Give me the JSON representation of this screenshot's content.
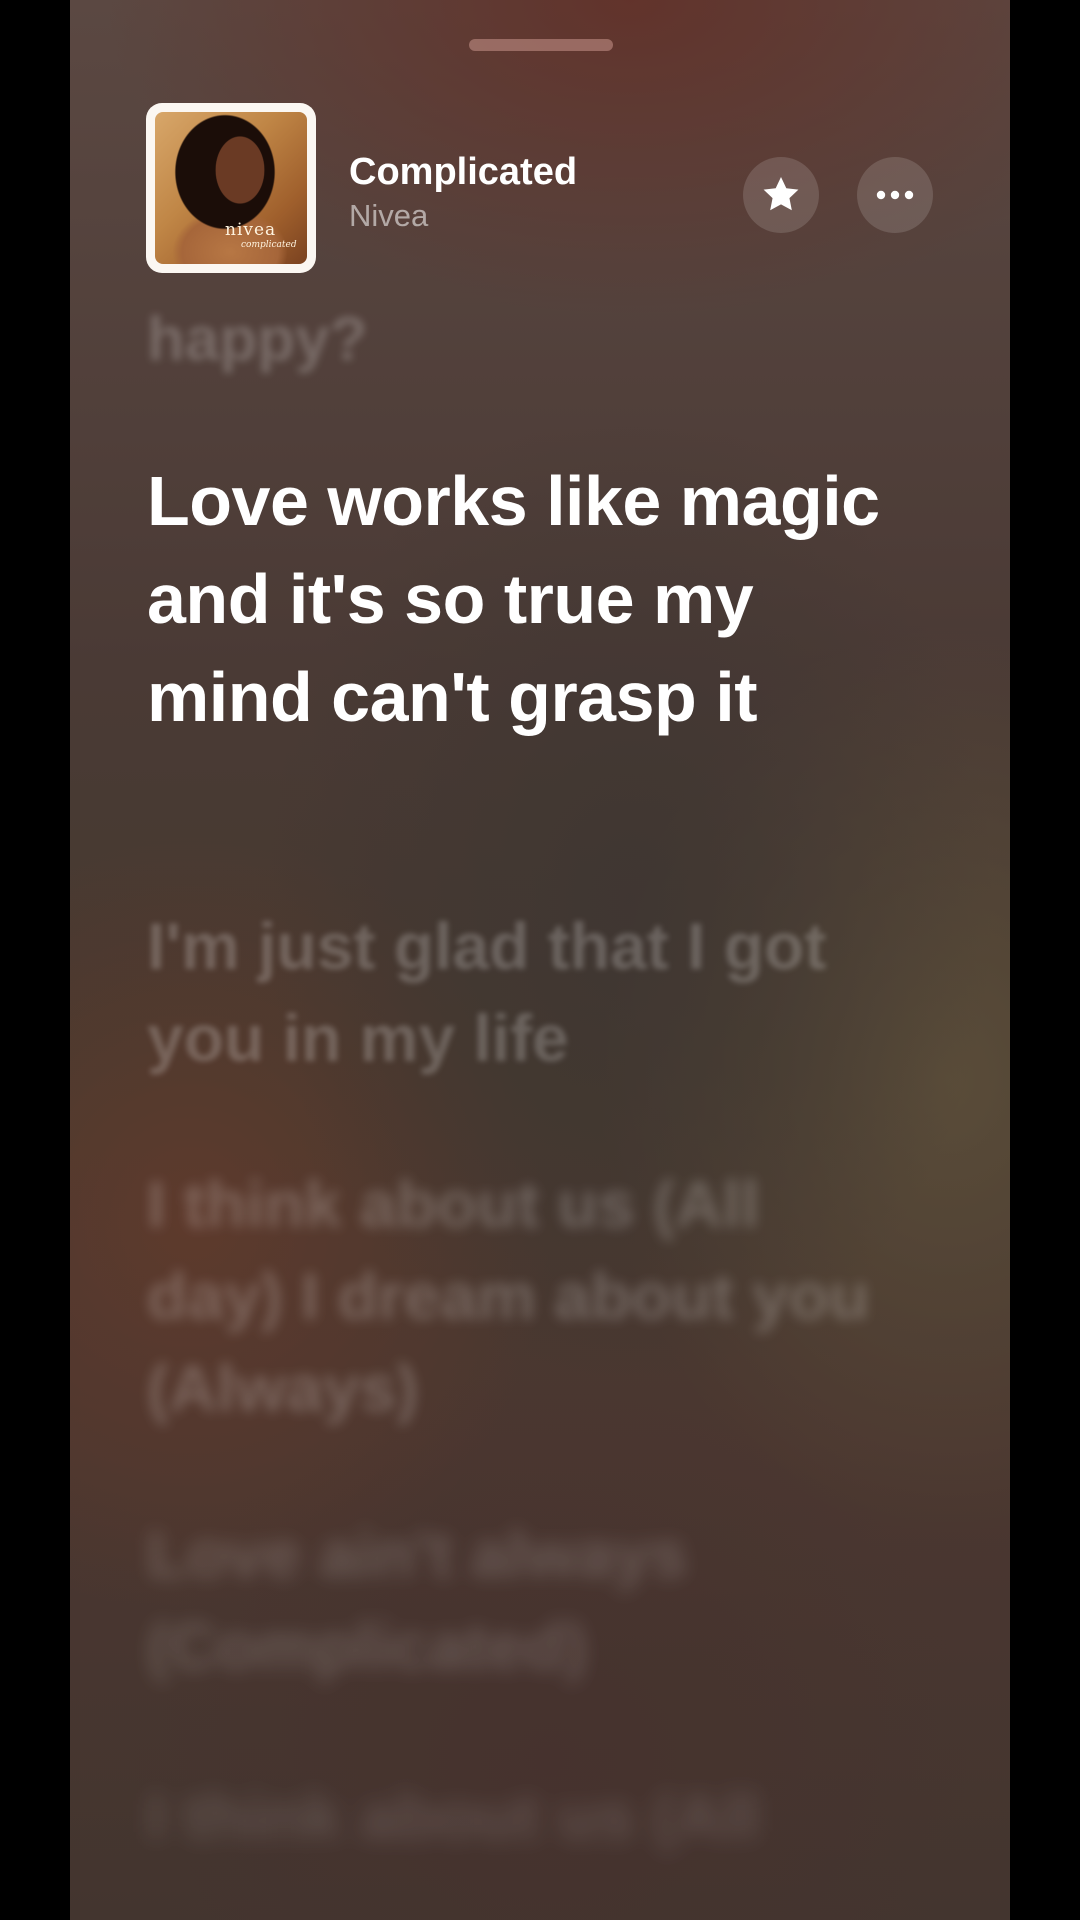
{
  "sheet": {
    "grabber": "drag-handle"
  },
  "now_playing": {
    "artwork": {
      "icon": "album-art",
      "text": "nivea",
      "subtext": "complicated"
    },
    "title": "Complicated",
    "artist": "Nivea",
    "favorite_icon": "star-icon",
    "more_icon": "ellipsis-icon"
  },
  "lyrics": {
    "previous": "happy?",
    "current": "Love works like magic and it's so true my mind can't grasp it",
    "upcoming": [
      "I'm just glad that I got you in my life",
      "I think about us (All day) I dream about you (Always)",
      "Love ain't always (Complicated)",
      "I think about us (All"
    ]
  },
  "colors": {
    "text_primary": "#ffffff",
    "text_secondary": "rgba(255,255,255,0.55)",
    "button_bg": "rgba(255,255,255,0.14)"
  }
}
